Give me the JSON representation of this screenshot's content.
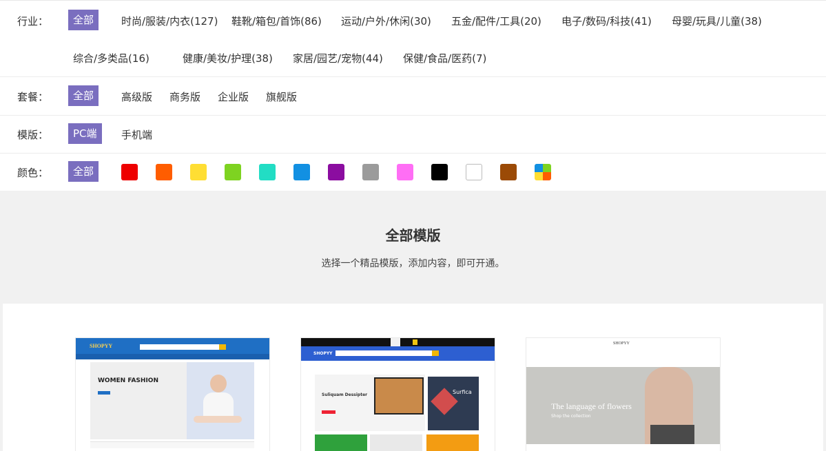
{
  "filters": {
    "industry": {
      "label": "行业：",
      "selected": "全部",
      "options": [
        "时尚/服装/内衣(127)",
        "鞋靴/箱包/首饰(86)",
        "运动/户外/休闲(30)",
        "五金/配件/工具(20)",
        "电子/数码/科技(41)",
        "母婴/玩具/儿童(38)",
        "综合/多类品(16)",
        "健康/美妆/护理(38)",
        "家居/园艺/宠物(44)",
        "保健/食品/医药(7)"
      ]
    },
    "plan": {
      "label": "套餐：",
      "selected": "全部",
      "options": [
        "高级版",
        "商务版",
        "企业版",
        "旗舰版"
      ]
    },
    "template": {
      "label": "模版：",
      "selected": "PC端",
      "options": [
        "手机端"
      ]
    },
    "color": {
      "label": "颜色：",
      "selected": "全部",
      "swatches": [
        {
          "name": "red",
          "hex": "#ee0000"
        },
        {
          "name": "orange",
          "hex": "#ff5d00"
        },
        {
          "name": "yellow",
          "hex": "#ffde33"
        },
        {
          "name": "green",
          "hex": "#7ed321"
        },
        {
          "name": "cyan",
          "hex": "#22ddc4"
        },
        {
          "name": "blue",
          "hex": "#1290e2"
        },
        {
          "name": "purple",
          "hex": "#8b0da0"
        },
        {
          "name": "gray",
          "hex": "#9b9b9b"
        },
        {
          "name": "pink",
          "hex": "#ff6ef5"
        },
        {
          "name": "black",
          "hex": "#000000"
        },
        {
          "name": "white",
          "hex": "#ffffff"
        },
        {
          "name": "brown",
          "hex": "#9b4a06"
        },
        {
          "name": "multicolor",
          "hex": "multi"
        }
      ]
    },
    "accent": "#7a6ebf"
  },
  "section": {
    "title": "全部模版",
    "subtitle": "选择一个精品模版，添加内容，即可开通。"
  },
  "thumbs": [
    {
      "logo": "SHOPYY",
      "hero": "WOMEN FASHION",
      "accent": "#1f6fc4"
    },
    {
      "logo": "SHOPYY",
      "hero_title": "Suliquam Dessipter",
      "side_title": "Surfica",
      "accent": "#2d5fd1"
    },
    {
      "logo": "SHOPYY",
      "hero": "The language of flowers",
      "hero_sub": "Shop the collection"
    }
  ]
}
